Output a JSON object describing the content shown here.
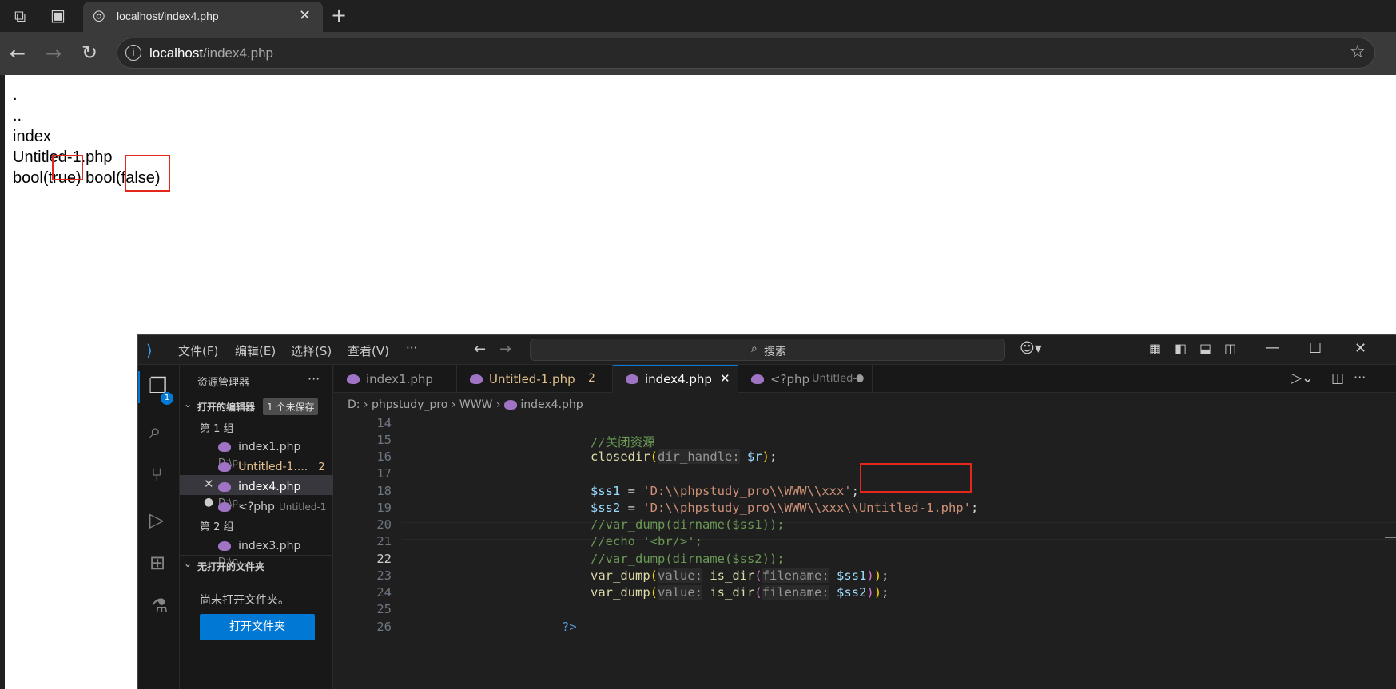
{
  "browser": {
    "tab_title": "localhost/index4.php",
    "url_host": "localhost",
    "url_path": "/index4.php"
  },
  "page": {
    "lines": [
      ".",
      "..",
      "index",
      "Untitled-1.php"
    ],
    "bool_prefix": "bool(",
    "bool_true": "true",
    "bool_mid": ") bool(",
    "bool_false": "false)"
  },
  "vscode": {
    "menu": [
      "文件(F)",
      "编辑(E)",
      "选择(S)",
      "查看(V)",
      "···"
    ],
    "search_label": "搜索",
    "explorer_title": "资源管理器",
    "open_editors_title": "打开的编辑器",
    "unsaved_badge": "1 个未保存",
    "group1": "第 1 组",
    "group2": "第 2 组",
    "open_editors": [
      {
        "name": "index1.php",
        "path": "D:\\p..."
      },
      {
        "name": "Untitled-1....",
        "path": "2"
      },
      {
        "name": "index4.php",
        "path": "D:\\p..."
      },
      {
        "name": "<?php",
        "path": "Untitled-1"
      },
      {
        "name": "index3.php",
        "path": "D:\\p..."
      }
    ],
    "no_folder_title": "无打开的文件夹",
    "no_folder_text": "尚未打开文件夹。",
    "open_folder_button": "打开文件夹",
    "scm_badge": "1",
    "tabs": [
      {
        "label": "index1.php",
        "extra": ""
      },
      {
        "label": "Untitled-1.php",
        "extra": "2"
      },
      {
        "label": "index4.php",
        "extra": ""
      },
      {
        "label": "<?php",
        "extra": "Untitled-1"
      }
    ],
    "breadcrumb": [
      "D:",
      "phpstudy_pro",
      "WWW",
      "index4.php"
    ],
    "line_numbers": [
      "14",
      "15",
      "16",
      "17",
      "18",
      "19",
      "20",
      "21",
      "22",
      "23",
      "24",
      "25",
      "26"
    ],
    "code": {
      "l15": "//关闭资源",
      "l16_fn": "closedir",
      "l16_hint": "dir_handle:",
      "l16_var": "$r",
      "l18_var": "$ss1",
      "l18_str": "'D:\\\\phpstudy_pro\\\\WWW\\\\xxx'",
      "l19_var": "$ss2",
      "l19_str_a": "'D:\\\\phpstudy_pro\\\\WWW\\\\xxx\\",
      "l19_str_b": "\\Untitled-1.php'",
      "l20": "//var_dump(dirname($ss1));",
      "l21": "//echo '<br/>';",
      "l22": "//var_dump(dirname($ss2));",
      "l23_fn": "var_dump",
      "l23_hint1": "value:",
      "l23_fn2": "is_dir",
      "l23_hint2": "filename:",
      "l23_var": "$ss1",
      "l24_var": "$ss2",
      "l26": "?>"
    }
  }
}
